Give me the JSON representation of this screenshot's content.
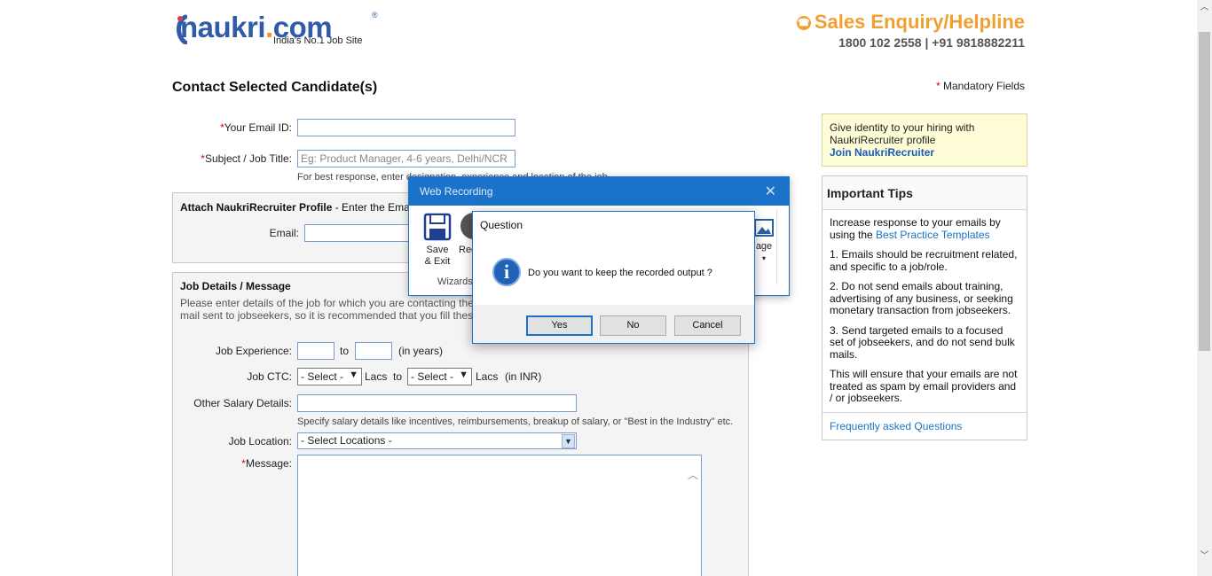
{
  "header": {
    "logo_text": "naukri",
    "logo_dot": ".",
    "logo_com": "com",
    "logo_reg": "®",
    "tagline": "India's No.1 Job Site",
    "helpline_title": "Sales Enquiry/Helpline",
    "helpline_numbers": "1800 102 2558 | +91 9818882211"
  },
  "page": {
    "title": "Contact Selected Candidate(s)",
    "mandatory_star": "*",
    "mandatory_text": " Mandatory Fields"
  },
  "form": {
    "email_label": "Your Email ID:",
    "email_value": "",
    "subject_label": "Subject / Job Title:",
    "subject_placeholder": "Eg: Product Manager, 4-6 years, Delhi/NCR",
    "subject_note": "For best response, enter designation, experience and location of the job",
    "attach_title": "Attach NaukriRecruiter Profile",
    "attach_subtitle": " - Enter the Ema",
    "attach_email_label": "Email:",
    "job_title": "Job Details / Message",
    "job_desc_line1": "Please enter details of the job for which you are contacting the",
    "job_desc_line2": "mail sent to jobseekers, so it is recommended that you fill thes",
    "exp_label": "Job Experience:",
    "exp_to": "to",
    "exp_unit": "(in years)",
    "ctc_label": "Job CTC:",
    "ctc_from": "- Select -",
    "ctc_lacs1": "Lacs",
    "ctc_to": "to",
    "ctc_to_sel": "- Select -",
    "ctc_lacs2": "Lacs",
    "ctc_unit": "(in INR)",
    "salary_label": "Other Salary Details:",
    "salary_note": "Specify salary details like incentives, reimbursements, breakup of salary, or \"Best in the Industry\" etc.",
    "location_label": "Job Location:",
    "location_value": "- Select Locations -",
    "message_label": "Message:",
    "req_star": "*"
  },
  "sidebar": {
    "promo_text": "Give identity to your hiring with NaukriRecruiter profile",
    "promo_link": "Join NaukriRecruiter",
    "tips_title": "Important Tips",
    "tip_intro": "Increase response to your emails by using the ",
    "tip_intro_link": "Best Practice Templates",
    "tip1": "1. Emails should be recruitment related, and specific to a job/role.",
    "tip2": "2. Do not send emails about training, advertising of any business, or seeking monetary transaction from jobseekers.",
    "tip3": "3. Send targeted emails to a focused set of jobseekers, and do not send bulk mails.",
    "tip4": "This will ensure that your emails are not treated as spam by email providers and / or jobseekers.",
    "faq_link": "Frequently asked Questions"
  },
  "web_recording": {
    "title": "Web Recording",
    "close": "✕",
    "save_label_1": "Save",
    "save_label_2": "& Exit",
    "rec_label": "Rec",
    "image_label": "age",
    "group_label": "Wizards"
  },
  "dialog": {
    "title": "Question",
    "message": "Do you want to keep the recorded output ?",
    "yes": "Yes",
    "no": "No",
    "cancel": "Cancel"
  }
}
